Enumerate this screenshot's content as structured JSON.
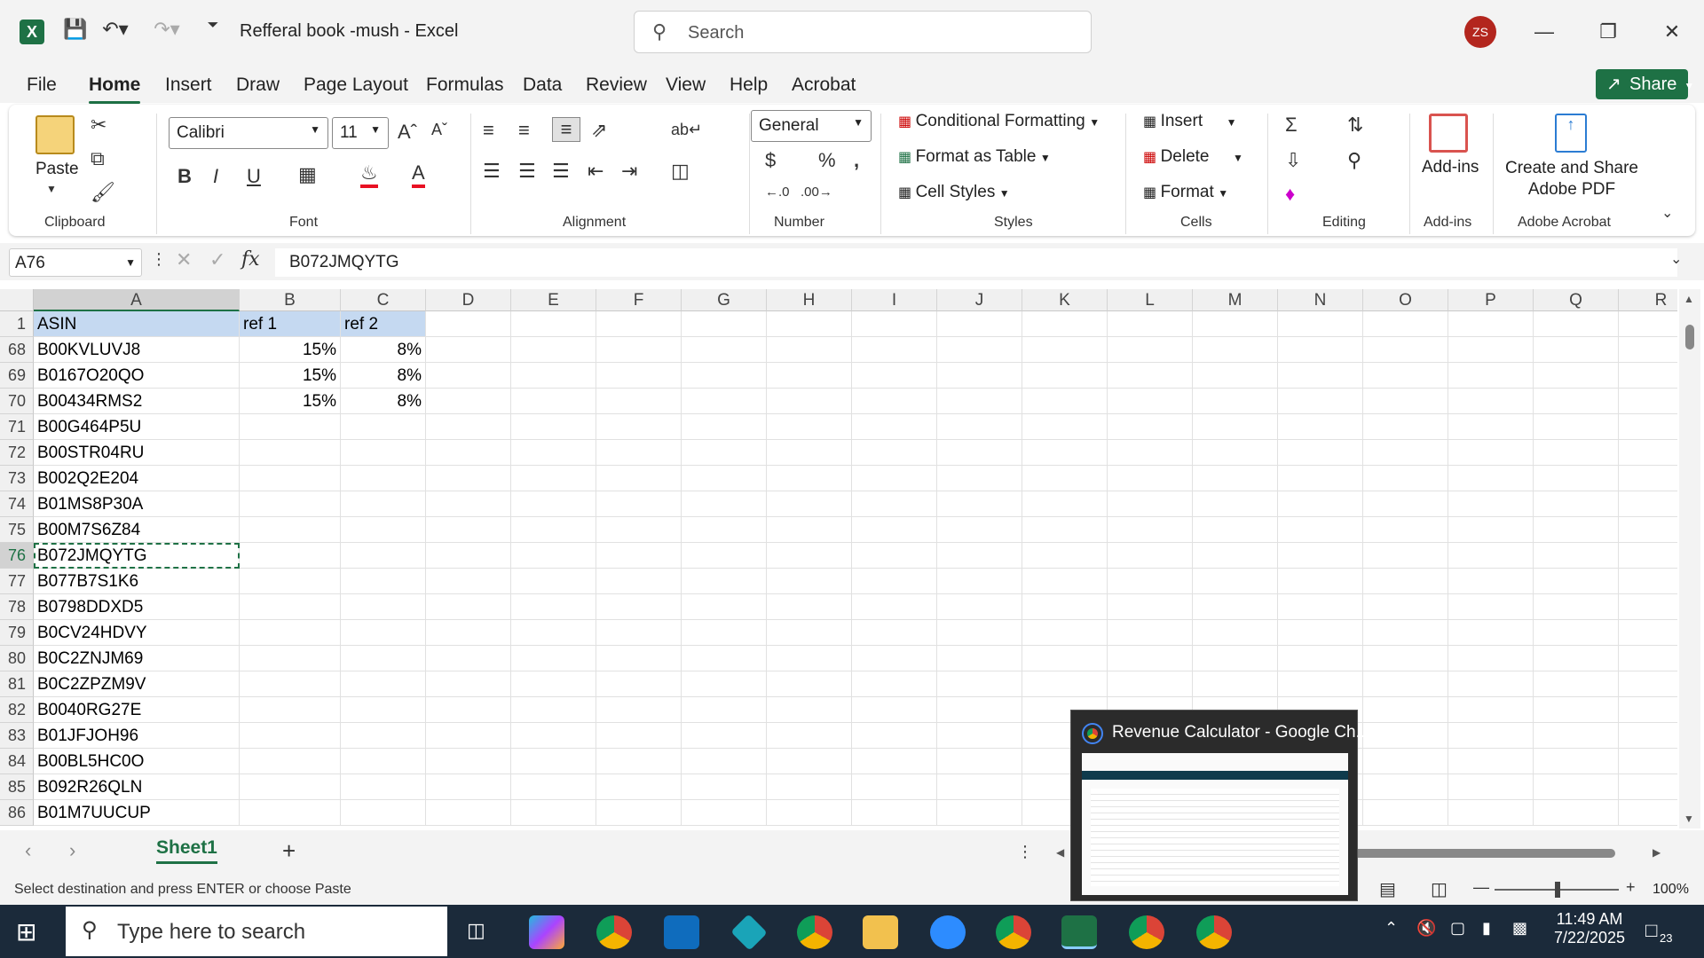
{
  "titlebar": {
    "doc_title": "Refferal book -mush  -  Excel",
    "search_placeholder": "Search",
    "avatar_initials": "ZS"
  },
  "menu": [
    "File",
    "Home",
    "Insert",
    "Draw",
    "Page Layout",
    "Formulas",
    "Data",
    "Review",
    "View",
    "Help",
    "Acrobat"
  ],
  "share_label": "Share",
  "ribbon": {
    "clipboard": {
      "paste": "Paste",
      "group": "Clipboard"
    },
    "font": {
      "name": "Calibri",
      "size": "11",
      "group": "Font",
      "bold": "B",
      "italic": "I",
      "underline": "U"
    },
    "alignment": {
      "group": "Alignment"
    },
    "number": {
      "format": "General",
      "group": "Number",
      "currency": "$",
      "percent": "%"
    },
    "styles": {
      "cond": "Conditional Formatting",
      "table": "Format as Table",
      "cell": "Cell Styles",
      "group": "Styles"
    },
    "cells": {
      "insert": "Insert",
      "delete": "Delete",
      "format": "Format",
      "group": "Cells"
    },
    "editing": {
      "group": "Editing"
    },
    "addins": {
      "label": "Add-ins",
      "group": "Add-ins"
    },
    "acrobat": {
      "label1": "Create and Share",
      "label2": "Adobe PDF",
      "group": "Adobe Acrobat"
    }
  },
  "formula_bar": {
    "name_box": "A76",
    "fx": "fx",
    "content": "B072JMQYTG"
  },
  "columns": [
    "A",
    "B",
    "C",
    "D",
    "E",
    "F",
    "G",
    "H",
    "I",
    "J",
    "K",
    "L",
    "M",
    "N",
    "O",
    "P",
    "Q",
    "R"
  ],
  "header_row": {
    "row": "1",
    "a": "ASIN",
    "b": "ref 1",
    "c": "ref 2"
  },
  "rows": [
    {
      "row": "68",
      "a": "B00KVLUVJ8",
      "b": "15%",
      "c": "8%"
    },
    {
      "row": "69",
      "a": "B0167O20QO",
      "b": "15%",
      "c": "8%"
    },
    {
      "row": "70",
      "a": "B00434RMS2",
      "b": "15%",
      "c": "8%"
    },
    {
      "row": "71",
      "a": "B00G464P5U",
      "b": "",
      "c": ""
    },
    {
      "row": "72",
      "a": "B00STR04RU",
      "b": "",
      "c": ""
    },
    {
      "row": "73",
      "a": "B002Q2E204",
      "b": "",
      "c": ""
    },
    {
      "row": "74",
      "a": "B01MS8P30A",
      "b": "",
      "c": ""
    },
    {
      "row": "75",
      "a": "B00M7S6Z84",
      "b": "",
      "c": ""
    },
    {
      "row": "76",
      "a": "B072JMQYTG",
      "b": "",
      "c": ""
    },
    {
      "row": "77",
      "a": "B077B7S1K6",
      "b": "",
      "c": ""
    },
    {
      "row": "78",
      "a": "B0798DDXD5",
      "b": "",
      "c": ""
    },
    {
      "row": "79",
      "a": "B0CV24HDVY",
      "b": "",
      "c": ""
    },
    {
      "row": "80",
      "a": "B0C2ZNJM69",
      "b": "",
      "c": ""
    },
    {
      "row": "81",
      "a": "B0C2ZPZM9V",
      "b": "",
      "c": ""
    },
    {
      "row": "82",
      "a": "B0040RG27E",
      "b": "",
      "c": ""
    },
    {
      "row": "83",
      "a": "B01JFJOH96",
      "b": "",
      "c": ""
    },
    {
      "row": "84",
      "a": "B00BL5HC0O",
      "b": "",
      "c": ""
    },
    {
      "row": "85",
      "a": "B092R26QLN",
      "b": "",
      "c": ""
    },
    {
      "row": "86",
      "a": "B01M7UUCUP",
      "b": "",
      "c": ""
    }
  ],
  "sheet_tab": "Sheet1",
  "status_message": "Select destination and press ENTER or choose Paste",
  "zoom": "100%",
  "popup_title": "Revenue Calculator - Google Ch...",
  "taskbar": {
    "search_placeholder": "Type here to search",
    "time": "11:49 AM",
    "date": "7/22/2025",
    "notifications": "23"
  }
}
